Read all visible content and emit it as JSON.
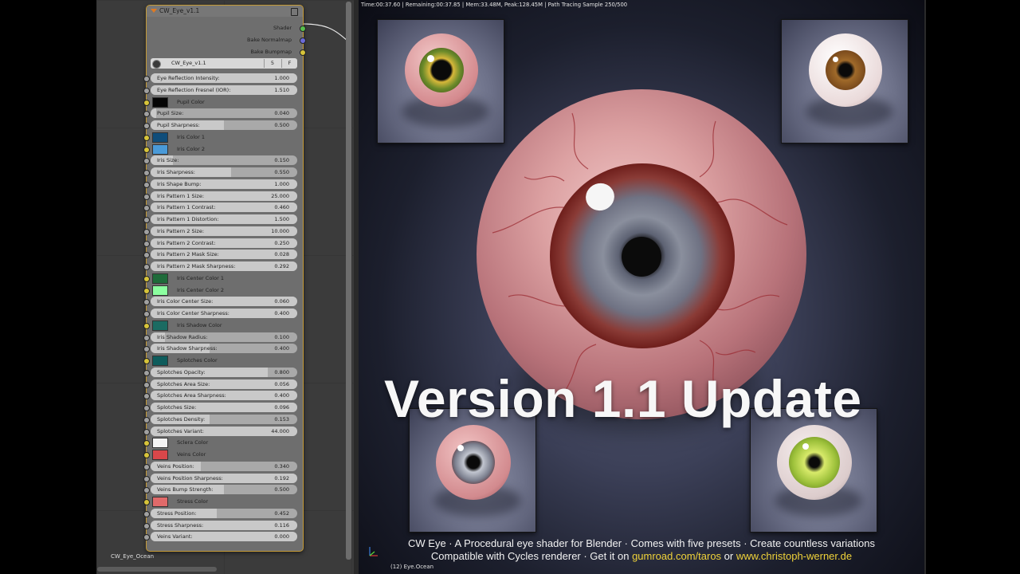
{
  "node_editor": {
    "node": {
      "title": "CW_Eye_v1.1",
      "outputs": [
        "Shader",
        "Bake Normalmap",
        "Bake Bumpmap"
      ],
      "group": {
        "name": "CW_Eye_v1.1",
        "users": "5",
        "fake": "F"
      },
      "inputs": [
        {
          "kind": "slider",
          "label": "Eye Reflection Intensity:",
          "value": "1.000",
          "fill": 1.0,
          "socket": "grey"
        },
        {
          "kind": "slider",
          "label": "Eye Reflection Fresnel (IOR):",
          "value": "1.510",
          "fill": 1.0,
          "socket": "grey"
        },
        {
          "kind": "color",
          "label": "Pupil Color",
          "color": "#050505",
          "socket": "yellow"
        },
        {
          "kind": "slider",
          "label": "Pupil Size:",
          "value": "0.040",
          "fill": 0.04,
          "socket": "grey"
        },
        {
          "kind": "slider",
          "label": "Pupil Sharpness:",
          "value": "0.500",
          "fill": 0.5,
          "socket": "grey"
        },
        {
          "kind": "color",
          "label": "Iris Color 1",
          "color": "#0f4d7a",
          "socket": "yellow"
        },
        {
          "kind": "color",
          "label": "Iris Color 2",
          "color": "#4a9ad8",
          "socket": "yellow"
        },
        {
          "kind": "slider",
          "label": "Iris Size:",
          "value": "0.150",
          "fill": 0.15,
          "socket": "grey"
        },
        {
          "kind": "slider",
          "label": "Iris Sharpness:",
          "value": "0.550",
          "fill": 0.55,
          "socket": "grey"
        },
        {
          "kind": "slider",
          "label": "Iris Shape Bump:",
          "value": "1.000",
          "fill": 1.0,
          "socket": "grey"
        },
        {
          "kind": "slider",
          "label": "Iris Pattern 1 Size:",
          "value": "25.000",
          "fill": 1.0,
          "socket": "grey"
        },
        {
          "kind": "slider",
          "label": "Iris Pattern 1 Contrast:",
          "value": "0.460",
          "fill": 1.0,
          "socket": "grey"
        },
        {
          "kind": "slider",
          "label": "Iris Pattern 1 Distortion:",
          "value": "1.500",
          "fill": 1.0,
          "socket": "grey"
        },
        {
          "kind": "slider",
          "label": "Iris Pattern 2 Size:",
          "value": "10.000",
          "fill": 1.0,
          "socket": "grey"
        },
        {
          "kind": "slider",
          "label": "Iris Pattern 2 Contrast:",
          "value": "0.250",
          "fill": 1.0,
          "socket": "grey"
        },
        {
          "kind": "slider",
          "label": "Iris Pattern 2 Mask Size:",
          "value": "0.028",
          "fill": 1.0,
          "socket": "grey"
        },
        {
          "kind": "slider",
          "label": "Iris Pattern 2 Mask Sharpness:",
          "value": "0.292",
          "fill": 1.0,
          "socket": "grey"
        },
        {
          "kind": "color",
          "label": "Iris Center Color 1",
          "color": "#1f6b3a",
          "socket": "yellow"
        },
        {
          "kind": "color",
          "label": "Iris Center Color 2",
          "color": "#8cffa0",
          "socket": "yellow"
        },
        {
          "kind": "slider",
          "label": "Iris Color Center Size:",
          "value": "0.060",
          "fill": 1.0,
          "socket": "grey"
        },
        {
          "kind": "slider",
          "label": "Iris Color Center Sharpness:",
          "value": "0.400",
          "fill": 1.0,
          "socket": "grey"
        },
        {
          "kind": "color",
          "label": "Iris Shadow Color",
          "color": "#1b6b62",
          "socket": "yellow"
        },
        {
          "kind": "slider",
          "label": "Iris Shadow Radius:",
          "value": "0.100",
          "fill": 0.1,
          "socket": "grey"
        },
        {
          "kind": "slider",
          "label": "Iris Shadow Sharpness:",
          "value": "0.400",
          "fill": 0.4,
          "socket": "grey"
        },
        {
          "kind": "color",
          "label": "Splotches Color",
          "color": "#0e5c5c",
          "socket": "yellow"
        },
        {
          "kind": "slider",
          "label": "Splotches Opacity:",
          "value": "0.800",
          "fill": 0.8,
          "socket": "grey"
        },
        {
          "kind": "slider",
          "label": "Splotches Area Size:",
          "value": "0.056",
          "fill": 1.0,
          "socket": "grey"
        },
        {
          "kind": "slider",
          "label": "Splotches Area Sharpness:",
          "value": "0.400",
          "fill": 1.0,
          "socket": "grey"
        },
        {
          "kind": "slider",
          "label": "Splotches Size:",
          "value": "0.096",
          "fill": 1.0,
          "socket": "grey"
        },
        {
          "kind": "slider",
          "label": "Splotches Density:",
          "value": "0.153",
          "fill": 0.4,
          "socket": "grey"
        },
        {
          "kind": "slider",
          "label": "Splotches Variant:",
          "value": "44.000",
          "fill": 1.0,
          "socket": "grey"
        },
        {
          "kind": "color",
          "label": "Sclera Color",
          "color": "#f4f4f4",
          "socket": "yellow"
        },
        {
          "kind": "color",
          "label": "Veins Color",
          "color": "#d9474a",
          "socket": "yellow"
        },
        {
          "kind": "slider",
          "label": "Veins Position:",
          "value": "0.340",
          "fill": 0.34,
          "socket": "grey"
        },
        {
          "kind": "slider",
          "label": "Veins Position Sharpness:",
          "value": "0.192",
          "fill": 1.0,
          "socket": "grey"
        },
        {
          "kind": "slider",
          "label": "Veins Bump Strength:",
          "value": "0.500",
          "fill": 0.5,
          "socket": "grey"
        },
        {
          "kind": "color",
          "label": "Stress Color",
          "color": "#e06a6a",
          "socket": "yellow"
        },
        {
          "kind": "slider",
          "label": "Stress Position:",
          "value": "0.452",
          "fill": 0.45,
          "socket": "grey"
        },
        {
          "kind": "slider",
          "label": "Stress  Sharpness:",
          "value": "0.116",
          "fill": 1.0,
          "socket": "grey"
        },
        {
          "kind": "slider",
          "label": "Veins Variant:",
          "value": "0.000",
          "fill": 1.0,
          "socket": "grey"
        }
      ]
    },
    "material_label": "CW_Eye_Ocean"
  },
  "render": {
    "stats": "Time:00:37.60 | Remaining:00:37.85 | Mem:33.48M, Peak:128.45M | Path Tracing Sample 250/500",
    "title": "Version 1.1 Update",
    "desc_line1": "CW Eye · A Procedural eye shader for Blender · Comes with five presets · Create countless variations",
    "desc_line2_prefix": "Compatible with Cycles renderer · Get it on ",
    "link1": "gumroad.com/taros",
    "desc_line2_mid": " or ",
    "link2": "www.christoph-werner.de",
    "object_label": "(12) Eye.Ocean",
    "previews": [
      {
        "name": "green-eye",
        "iris": "#6b8a2a",
        "iris_inner": "#d8b83a",
        "sclera": "#e8b3b3"
      },
      {
        "name": "brown-eye",
        "iris": "#7a4a1c",
        "iris_inner": "#a06a2a",
        "sclera": "#f0e6e6"
      },
      {
        "name": "grey-eye",
        "iris": "#7b7f8e",
        "iris_inner": "#c2c6d0",
        "sclera": "#e8a9ac"
      },
      {
        "name": "yellow-eye",
        "iris": "#9cc03a",
        "iris_inner": "#d8ea6a",
        "sclera": "#eadede"
      }
    ]
  }
}
